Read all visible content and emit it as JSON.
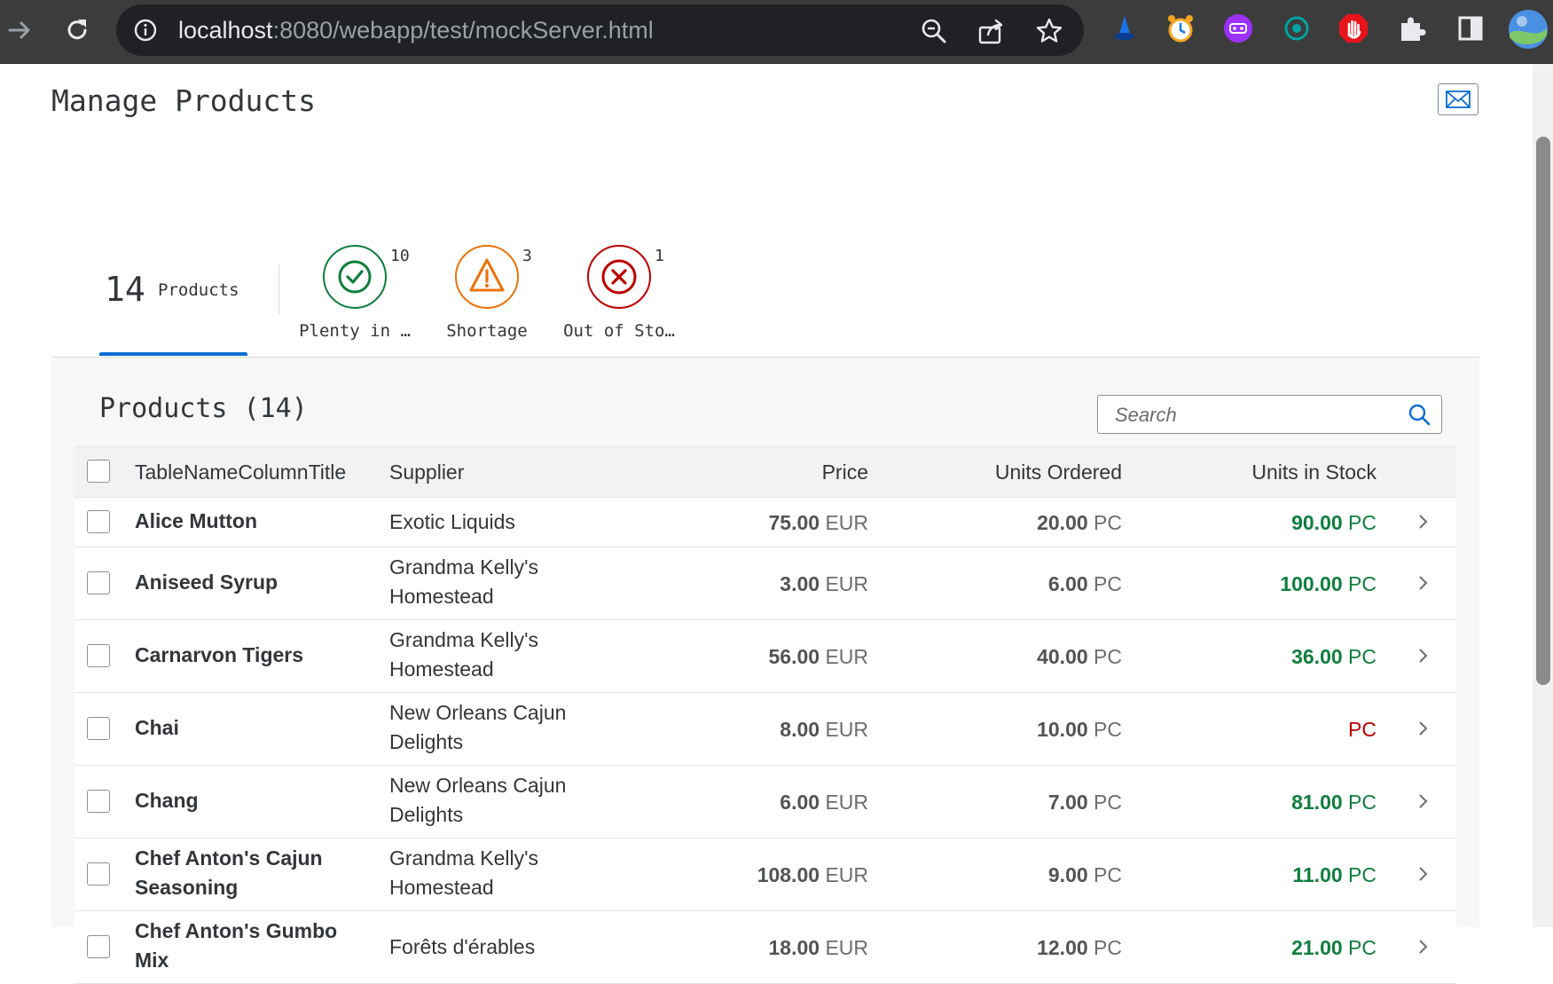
{
  "browser": {
    "url_host": "localhost",
    "url_rest": ":8080/webapp/test/mockServer.html"
  },
  "page": {
    "title": "Manage Products"
  },
  "tabs": {
    "count_value": "14",
    "count_label": "Products",
    "filters": [
      {
        "label": "Plenty in …",
        "count": "10",
        "color": "#107e3e",
        "icon": "check-circle-icon"
      },
      {
        "label": "Shortage",
        "count": "3",
        "color": "#e9730c",
        "icon": "warning-icon"
      },
      {
        "label": "Out of Sto…",
        "count": "1",
        "color": "#bb0000",
        "icon": "error-circle-icon"
      }
    ]
  },
  "table": {
    "title": "Products (14)",
    "search_placeholder": "Search",
    "columns": {
      "name": "TableNameColumnTitle",
      "supplier": "Supplier",
      "price": "Price",
      "ordered": "Units Ordered",
      "stock": "Units in Stock"
    },
    "rows": [
      {
        "name": "Alice Mutton",
        "supplier": "Exotic Liquids",
        "price": "75.00",
        "price_unit": "EUR",
        "ordered": "20.00",
        "ordered_unit": "PC",
        "stock": "90.00",
        "stock_unit": "PC",
        "stock_state": "good"
      },
      {
        "name": "Aniseed Syrup",
        "supplier": "Grandma Kelly's Homestead",
        "price": "3.00",
        "price_unit": "EUR",
        "ordered": "6.00",
        "ordered_unit": "PC",
        "stock": "100.00",
        "stock_unit": "PC",
        "stock_state": "good"
      },
      {
        "name": "Carnarvon Tigers",
        "supplier": "Grandma Kelly's Homestead",
        "price": "56.00",
        "price_unit": "EUR",
        "ordered": "40.00",
        "ordered_unit": "PC",
        "stock": "36.00",
        "stock_unit": "PC",
        "stock_state": "good"
      },
      {
        "name": "Chai",
        "supplier": "New Orleans Cajun Delights",
        "price": "8.00",
        "price_unit": "EUR",
        "ordered": "10.00",
        "ordered_unit": "PC",
        "stock": "",
        "stock_unit": "PC",
        "stock_state": "bad"
      },
      {
        "name": "Chang",
        "supplier": "New Orleans Cajun Delights",
        "price": "6.00",
        "price_unit": "EUR",
        "ordered": "7.00",
        "ordered_unit": "PC",
        "stock": "81.00",
        "stock_unit": "PC",
        "stock_state": "good"
      },
      {
        "name": "Chef Anton's Cajun Seasoning",
        "supplier": "Grandma Kelly's Homestead",
        "price": "108.00",
        "price_unit": "EUR",
        "ordered": "9.00",
        "ordered_unit": "PC",
        "stock": "11.00",
        "stock_unit": "PC",
        "stock_state": "good"
      },
      {
        "name": "Chef Anton's Gumbo Mix",
        "supplier": "Forêts d'érables",
        "price": "18.00",
        "price_unit": "EUR",
        "ordered": "12.00",
        "ordered_unit": "PC",
        "stock": "21.00",
        "stock_unit": "PC",
        "stock_state": "good"
      }
    ]
  }
}
